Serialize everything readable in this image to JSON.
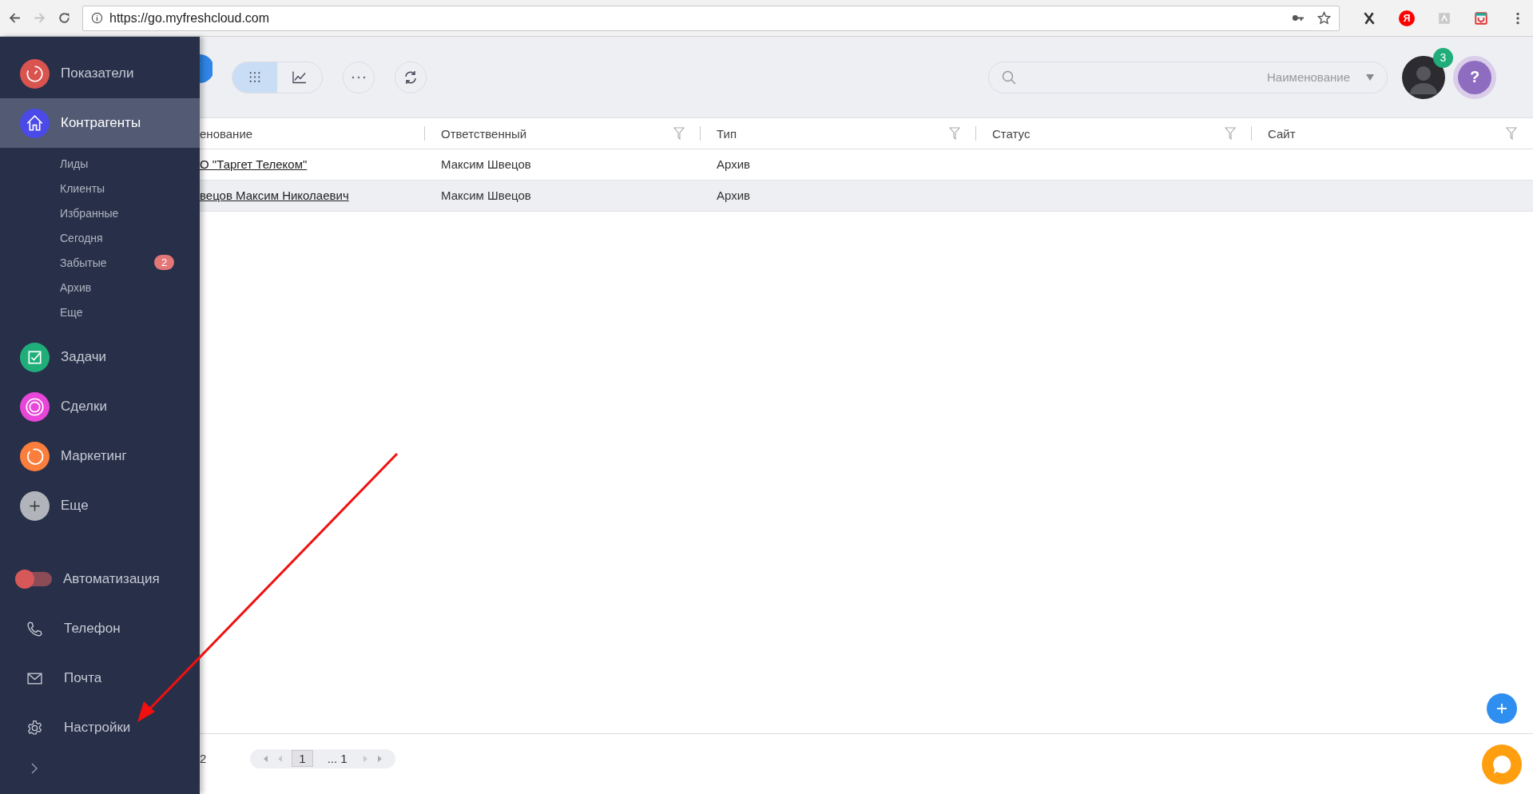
{
  "browser": {
    "url": "https://go.myfreshcloud.com",
    "yandex_label": "Я"
  },
  "sidebar": {
    "main_items": [
      {
        "kind": "circle",
        "label": "Показатели",
        "color": "#d9534f",
        "selected": false
      },
      {
        "kind": "circle",
        "label": "Контрагенты",
        "color": "#4b4ae8",
        "selected": true,
        "children": [
          {
            "label": "Лиды"
          },
          {
            "label": "Клиенты"
          },
          {
            "label": "Избранные"
          },
          {
            "label": "Сегодня"
          },
          {
            "label": "Забытые",
            "badge": "2"
          },
          {
            "label": "Архив"
          },
          {
            "label": "Еще"
          }
        ]
      },
      {
        "kind": "circle",
        "label": "Задачи",
        "color": "#1fae7a",
        "selected": false
      },
      {
        "kind": "circle",
        "label": "Сделки",
        "color": "#e846d9",
        "selected": false
      },
      {
        "kind": "circle",
        "label": "Маркетинг",
        "color": "#fb7e3c",
        "selected": false
      },
      {
        "kind": "circle",
        "label": "Еще",
        "color": "#b1b4bb",
        "selected": false
      }
    ],
    "tool_items": [
      {
        "kind": "toggle",
        "label": "Автоматизация",
        "on": false
      },
      {
        "kind": "plain",
        "label": "Телефон"
      },
      {
        "kind": "plain",
        "label": "Почта"
      },
      {
        "kind": "plain",
        "label": "Настройки"
      }
    ]
  },
  "toolbar": {
    "views": [
      {
        "selected": true
      },
      {
        "selected": false
      }
    ],
    "search": {
      "field": "Наименование"
    },
    "notifications": "3",
    "help": "?"
  },
  "table": {
    "columns": [
      {
        "label": "енование",
        "filter": false
      },
      {
        "label": "Ответственный",
        "filter": true
      },
      {
        "label": "Тип",
        "filter": true
      },
      {
        "label": "Статус",
        "filter": true
      },
      {
        "label": "Сайт",
        "filter": true
      }
    ],
    "rows": [
      {
        "selected": false,
        "cells": [
          "О \"Таргет Телеком\"",
          "Максим Швецов",
          "Архив"
        ]
      },
      {
        "selected": true,
        "cells": [
          "вецов Максим Николаевич",
          "Максим Швецов",
          "Архив"
        ]
      }
    ]
  },
  "footer": {
    "count": "2",
    "pages": [
      {
        "label": "1",
        "selected": true
      },
      {
        "label": "... 1",
        "selected": false
      }
    ]
  }
}
